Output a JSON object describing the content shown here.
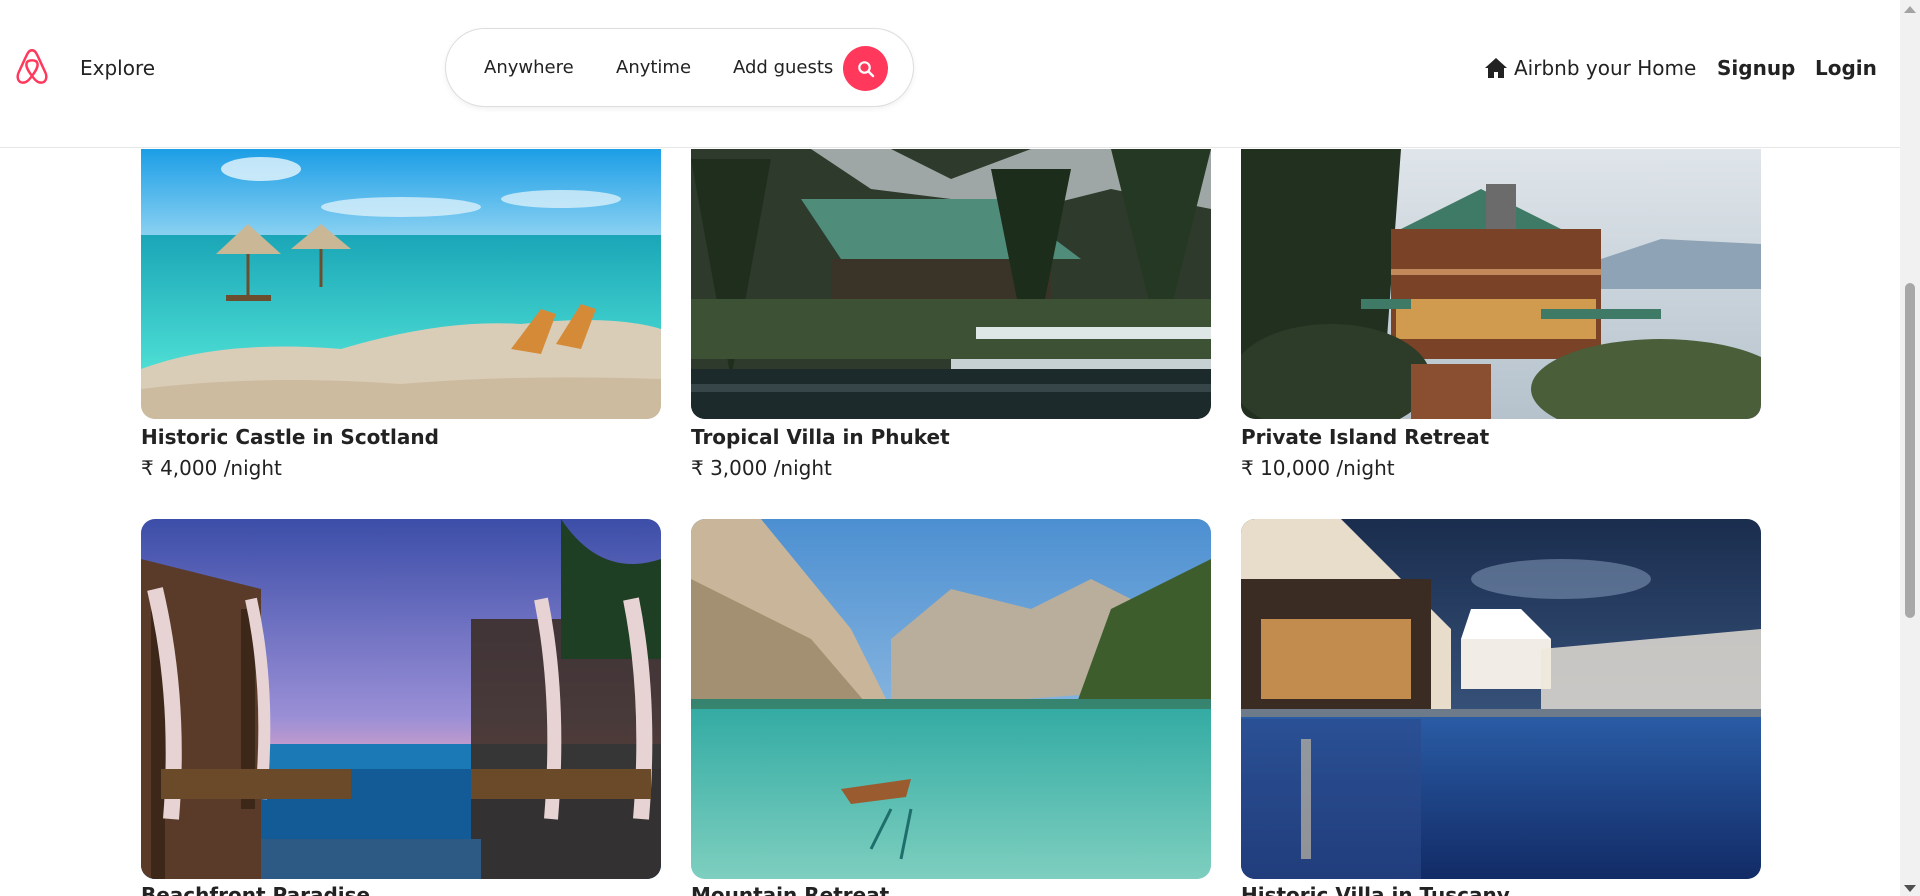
{
  "header": {
    "logo_icon": "airbnb-logo-icon",
    "explore_label": "Explore",
    "search": {
      "anywhere": "Anywhere",
      "anytime": "Anytime",
      "guests": "Add guests",
      "button_icon": "search-icon"
    },
    "host_label": "Airbnb your Home",
    "host_icon": "home-icon",
    "signup_label": "Signup",
    "login_label": "Login"
  },
  "colors": {
    "brand": "#ff385c",
    "text": "#222222"
  },
  "listings": [
    {
      "title": "Historic Castle in Scotland",
      "price": "₹ 4,000 /night",
      "image": "tropical beach with umbrellas"
    },
    {
      "title": "Tropical Villa in Phuket",
      "price": "₹ 3,000 /night",
      "image": "cabin by forest lake"
    },
    {
      "title": "Private Island Retreat",
      "price": "₹ 10,000 /night",
      "image": "wooden lodge at dusk"
    },
    {
      "title": "Beachfront Paradise",
      "price": "",
      "image": "infinity pool cabanas at sunset"
    },
    {
      "title": "Mountain Retreat",
      "price": "",
      "image": "alpine lake with rowboat"
    },
    {
      "title": "Historic Villa in Tuscany",
      "price": "",
      "image": "resort pool at night"
    }
  ]
}
